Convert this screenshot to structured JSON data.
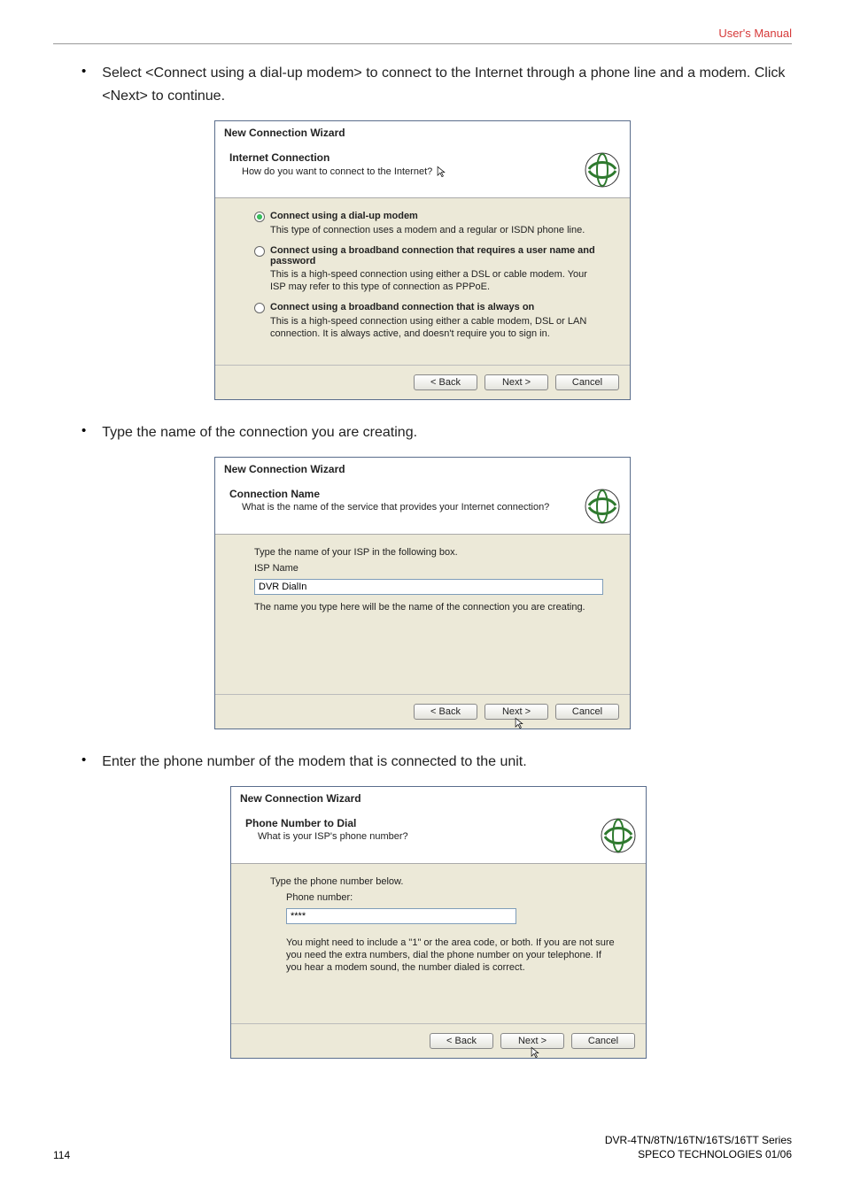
{
  "header": {
    "title": "User's  Manual"
  },
  "intro": {
    "bullet1": "Select <Connect using a dial-up modem> to connect to the Internet through a phone line and a modem. Click <Next> to continue.",
    "bullet2": "Type the name of the connection you are creating.",
    "bullet3": "Enter the phone number of the modem that is connected to the unit."
  },
  "dialog1": {
    "window_title": "New Connection Wizard",
    "title": "Internet Connection",
    "sub": "How do you want to connect to the Internet?",
    "opt1_label": "Connect using a dial-up modem",
    "opt1_desc": "This type of connection uses a modem and a regular or ISDN phone line.",
    "opt2_label": "Connect using a broadband connection that requires a user name and password",
    "opt2_desc": "This is a high-speed connection using either a DSL or cable modem. Your ISP may refer to this type of connection as PPPoE.",
    "opt3_label": "Connect using a broadband connection that is always on",
    "opt3_desc": "This is a high-speed connection using either a cable modem, DSL or LAN connection. It is always active, and doesn't require you to sign in.",
    "back": "< Back",
    "next": "Next >",
    "cancel": "Cancel"
  },
  "dialog2": {
    "window_title": "New Connection Wizard",
    "title": "Connection Name",
    "sub": "What is the name of the service that provides your Internet connection?",
    "prompt": "Type the name of your ISP in the following box.",
    "field_label": "ISP Name",
    "field_value": "DVR DialIn",
    "hint": "The name you type here will be the name of the connection you are creating.",
    "back": "< Back",
    "next": "Next >",
    "cancel": "Cancel"
  },
  "dialog3": {
    "window_title": "New Connection Wizard",
    "title": "Phone Number to Dial",
    "sub": "What is your ISP's phone number?",
    "prompt": "Type the phone number below.",
    "field_label": "Phone number:",
    "field_value": "****",
    "hint": "You might need to include a \"1\" or the area code, or both. If you are not sure you need the extra numbers, dial the phone number on your telephone. If you hear a modem sound, the number dialed is correct.",
    "back": "< Back",
    "next": "Next >",
    "cancel": "Cancel"
  },
  "footer": {
    "page_no": "114",
    "line1": "DVR-4TN/8TN/16TN/16TS/16TT Series",
    "line2": "SPECO TECHNOLOGIES 01/06"
  }
}
